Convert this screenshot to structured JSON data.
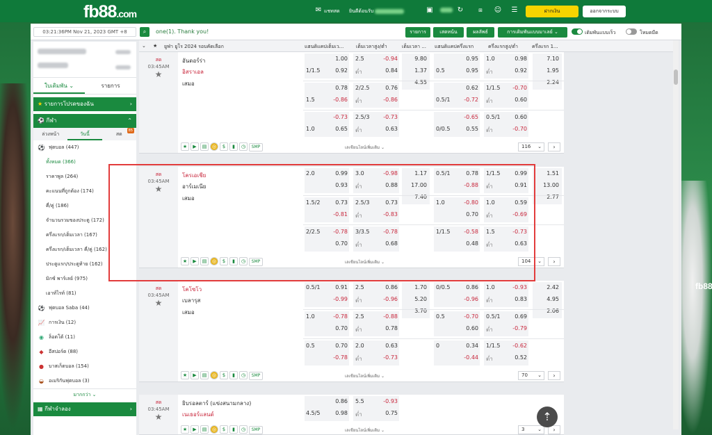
{
  "brand": {
    "logo": "fb88",
    "logo_suffix": ".com"
  },
  "topbar": {
    "chat": "แชทสด",
    "welcome": "ยินดีต้อนรับ",
    "deposit": "ฝากเงิน",
    "logout": "ออกจากระบบ",
    "balance_icon": "wallet-icon",
    "bell_icon": "bell-icon"
  },
  "toolbar": {
    "datetime": "03:21:36PM Nov 21, 2023 GMT +8",
    "marquee": "one(1). Thank you!",
    "btn_list": "รายการ",
    "btn_parlay": "เสตหน้น",
    "btn_result": "ผลลัพธ์",
    "btn_betlist": "การเดิมพันแบบมาเลย์",
    "toggle_quick": "เดิมพันแบบเร็ว",
    "toggle_night": "โหมดมืด"
  },
  "sidebar": {
    "tab_bet": "ใบเดิมพัน",
    "tab_list": "รายการ",
    "favorites": "รายการโปรดของฉัน",
    "sports": "กีฬา",
    "day_prev": "ล่วงหน้า",
    "day_today": "วันนี้",
    "day_live": "สด",
    "live_badge": "85",
    "soccer": "ฟุตบอล",
    "soccer_count": "(447)",
    "subitems": [
      {
        "label": "ทั้งหมด (366)",
        "active": true
      },
      {
        "label": "ราคาพูล (264)"
      },
      {
        "label": "คะแนนที่ถูกต้อง (174)"
      },
      {
        "label": "คี่/คู่ (186)"
      },
      {
        "label": "จำนวนรวมของประตู (172)"
      },
      {
        "label": "ครึ่งแรก/เต็มเวลา (167)"
      },
      {
        "label": "ครึ่งแรก/เต็มเวลา คี่/คู่ (162)"
      },
      {
        "label": "ประตูแรก/ประตูท้าย (162)"
      },
      {
        "label": "มิกซ์ พาร์เลย์ (975)"
      },
      {
        "label": "เอาท์ไรท์ (81)"
      }
    ],
    "other_sports": [
      {
        "label": "ฟุตบอล Saba (44)",
        "icon": "soccer-saba-icon"
      },
      {
        "label": "การเงิน (12)",
        "icon": "finance-icon"
      },
      {
        "label": "ล็อตโต้ (11)",
        "icon": "lotto-icon"
      },
      {
        "label": "อีสปอร์ต (88)",
        "icon": "esports-icon"
      },
      {
        "label": "บาสเก็ตบอล (154)",
        "icon": "basketball-icon"
      },
      {
        "label": "อเมริกันฟุตบอล (3)",
        "icon": "american-football-icon"
      }
    ],
    "more": "มากกว่า",
    "virtual": "กีฬาจำลอง"
  },
  "headers": {
    "league": "ยูฟ่า ยูโร 2024 รอบคัดเลือก",
    "c1": "แฮนดิแคปเต็มเว...",
    "c2": "เต็มเวลาสูง/ต่ำ",
    "c3": "เต็มเวลา ...",
    "c4": "แฮนดิแคปครึ่งแรก",
    "c5": "ครึ่งแรกสูง/ต่ำ",
    "c6": "ครึ่งแรก 1..."
  },
  "common": {
    "live": "สด",
    "time": "03:45AM",
    "draw": "เสมอ",
    "under": "ต่ำ",
    "more_bets": "เลเชียนไลน์เพิ่มเติม",
    "smp": "SMP"
  },
  "matches": [
    {
      "home": "อันดอร์ร่า",
      "away": "อิสราเอล",
      "home_red": false,
      "away_red": true,
      "page": "116",
      "rows": [
        {
          "h1": "",
          "o1a": "1.00",
          "h1b": "1/1.5",
          "o1b": "0.92",
          "ou": "2.5",
          "o2a": "-0.94",
          "o2b": "0.84",
          "x1": "9.80",
          "x2": "1.37",
          "x3": "4.55",
          "hh": "",
          "o4a": "0.95",
          "hh2": "0.5",
          "o4b": "0.95",
          "hou": "1.0",
          "o5a": "0.98",
          "o5b": "0.92",
          "y1": "7.10",
          "y2": "1.95",
          "y3": "2.24"
        },
        {
          "h1": "",
          "o1a": "0.78",
          "h1b": "1.5",
          "o1b": "-0.86",
          "ou": "2/2.5",
          "o2a": "0.76",
          "o2b": "-0.86",
          "hh": "",
          "o4a": "0.62",
          "hh2": "0.5/1",
          "o4b": "-0.72",
          "hou": "1/1.5",
          "o5a": "-0.70",
          "o5b": "0.60"
        },
        {
          "h1": "",
          "o1a": "-0.73",
          "h1b": "1.0",
          "o1b": "0.65",
          "ou": "2.5/3",
          "o2a": "-0.73",
          "o2b": "0.63",
          "hh": "",
          "o4a": "-0.65",
          "hh2": "0/0.5",
          "o4b": "0.55",
          "hou": "0.5/1",
          "o5a": "0.60",
          "o5b": "-0.70"
        }
      ]
    },
    {
      "home": "โครเอเชีย",
      "away": "อาร์เมเนีย",
      "home_red": true,
      "away_red": false,
      "page": "104",
      "rows": [
        {
          "h1": "2.0",
          "o1a": "0.99",
          "h1b": "",
          "o1b": "0.93",
          "ou": "3.0",
          "o2a": "-0.98",
          "o2b": "0.88",
          "x1": "1.17",
          "x2": "17.00",
          "x3": "7.40",
          "hh": "0.5/1",
          "o4a": "0.78",
          "hh2": "",
          "o4b": "-0.88",
          "hou": "1/1.5",
          "o5a": "0.99",
          "o5b": "0.91",
          "y1": "1.51",
          "y2": "13.00",
          "y3": "2.77"
        },
        {
          "h1": "1.5/2",
          "o1a": "0.73",
          "h1b": "",
          "o1b": "-0.81",
          "ou": "2.5/3",
          "o2a": "0.73",
          "o2b": "-0.83",
          "hh": "1.0",
          "o4a": "-0.80",
          "hh2": "",
          "o4b": "0.70",
          "hou": "1.0",
          "o5a": "0.59",
          "o5b": "-0.69"
        },
        {
          "h1": "2/2.5",
          "o1a": "-0.78",
          "h1b": "",
          "o1b": "0.70",
          "ou": "3/3.5",
          "o2a": "-0.78",
          "o2b": "0.68",
          "hh": "1/1.5",
          "o4a": "-0.58",
          "hh2": "",
          "o4b": "0.48",
          "hou": "1.5",
          "o5a": "-0.73",
          "o5b": "0.63"
        }
      ]
    },
    {
      "home": "โคโซโว",
      "away": "เบลารุส",
      "home_red": true,
      "away_red": false,
      "page": "70",
      "rows": [
        {
          "h1": "0.5/1",
          "o1a": "0.91",
          "h1b": "",
          "o1b": "-0.99",
          "ou": "2.5",
          "o2a": "0.86",
          "o2b": "-0.96",
          "x1": "1.70",
          "x2": "5.20",
          "x3": "3.70",
          "hh": "0/0.5",
          "o4a": "0.86",
          "hh2": "",
          "o4b": "-0.96",
          "hou": "1.0",
          "o5a": "-0.93",
          "o5b": "0.83",
          "y1": "2.42",
          "y2": "4.95",
          "y3": "2.06"
        },
        {
          "h1": "1.0",
          "o1a": "-0.78",
          "h1b": "",
          "o1b": "0.70",
          "ou": "2.5",
          "o2a": "-0.88",
          "o2b": "0.78",
          "hh": "0.5",
          "o4a": "-0.70",
          "hh2": "",
          "o4b": "0.60",
          "hou": "0.5/1",
          "o5a": "0.69",
          "o5b": "-0.79"
        },
        {
          "h1": "0.5",
          "o1a": "0.70",
          "h1b": "",
          "o1b": "-0.78",
          "ou": "2.0",
          "o2a": "0.63",
          "o2b": "-0.73",
          "hh": "0",
          "o4a": "0.34",
          "hh2": "",
          "o4b": "-0.44",
          "hou": "1/1.5",
          "o5a": "-0.62",
          "o5b": "0.52"
        }
      ]
    },
    {
      "home": "ยิบรอลตาร์ (แข่งสนามกลาง)",
      "away": "เนเธอร์แลนด์",
      "home_red": false,
      "away_red": true,
      "page": "3",
      "rows": [
        {
          "h1": "",
          "o1a": "0.86",
          "h1b": "4.5/5",
          "o1b": "0.98",
          "ou": "5.5",
          "o2a": "-0.93",
          "o2b": "0.75"
        }
      ]
    }
  ]
}
